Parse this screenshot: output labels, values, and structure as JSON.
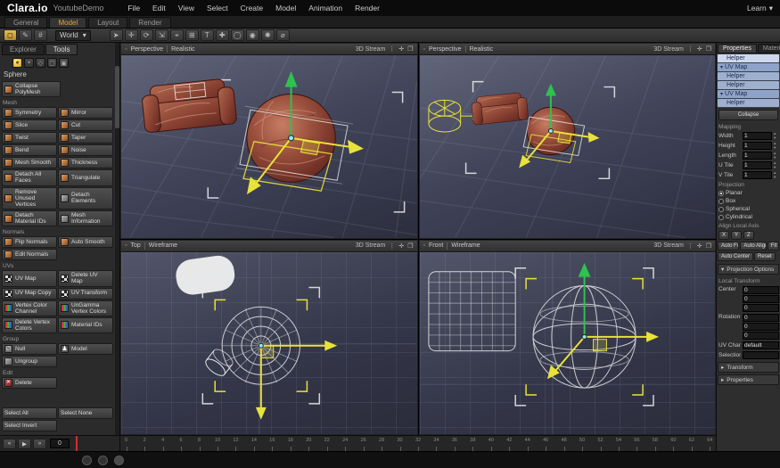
{
  "icons": {
    "caret_down": "▾",
    "caret_right": "▸",
    "kebab": "⋮",
    "move": "✛",
    "expand": "❐",
    "panel": "▫",
    "prev": "«",
    "play": "▶",
    "next": "»",
    "up": "▴",
    "down": "▾"
  },
  "colors": {
    "accent": "#f0a231",
    "gizmo_yellow": "#e8e23a",
    "gizmo_green": "#2ec24e",
    "selection_blue": "#9fb0cf"
  },
  "topbar": {
    "logo": "Clara.io",
    "project": "YoutubeDemo",
    "menus": [
      "File",
      "Edit",
      "View",
      "Select",
      "Create",
      "Model",
      "Animation",
      "Render"
    ],
    "learn": "Learn"
  },
  "tabbar": {
    "tabs": [
      "General",
      "Model",
      "Layout",
      "Render"
    ],
    "active": "Model"
  },
  "toolbar": {
    "left_icons": [
      {
        "name": "select-mode-icon",
        "glyph": "◻",
        "active": true
      },
      {
        "name": "paint-select-icon",
        "glyph": "✎",
        "active": false
      },
      {
        "name": "snap-toggle-icon",
        "glyph": "#",
        "active": false
      }
    ],
    "space_label": "World",
    "icons": [
      {
        "name": "select-tool-icon",
        "glyph": "➤"
      },
      {
        "name": "translate-tool-icon",
        "glyph": "✛"
      },
      {
        "name": "rotate-tool-icon",
        "glyph": "⟳"
      },
      {
        "name": "scale-tool-icon",
        "glyph": "⇲"
      },
      {
        "name": "pivot-tool-icon",
        "glyph": "⌖"
      },
      {
        "name": "snap-grid-icon",
        "glyph": "⊞"
      },
      {
        "name": "text-tool-icon",
        "glyph": "T"
      },
      {
        "name": "add-object-icon",
        "glyph": "✚"
      },
      {
        "name": "circle-tool-icon",
        "glyph": "◯"
      },
      {
        "name": "sphere-tool-icon",
        "glyph": "◉"
      },
      {
        "name": "light-tool-icon",
        "glyph": "✺"
      },
      {
        "name": "measure-tool-icon",
        "glyph": "⌀"
      }
    ]
  },
  "sidebar": {
    "tabs": [
      "Explorer",
      "Tools"
    ],
    "active_tab": "Tools",
    "mode_icons": [
      {
        "name": "object-mode-icon",
        "glyph": "●",
        "active": true
      },
      {
        "name": "vertex-mode-icon",
        "glyph": "▪",
        "active": false
      },
      {
        "name": "edge-mode-icon",
        "glyph": "◇",
        "active": false
      },
      {
        "name": "face-mode-icon",
        "glyph": "▢",
        "active": false
      },
      {
        "name": "element-mode-icon",
        "glyph": "▣",
        "active": false
      }
    ],
    "object_name": "Sphere",
    "collapse_button": "Collapse PolyMesh",
    "sections": [
      {
        "label": "Mesh",
        "buttons": [
          {
            "l": "Symmetry",
            "i": "mesh"
          },
          {
            "l": "Mirror",
            "i": "mesh"
          },
          {
            "l": "Slice",
            "i": "mesh"
          },
          {
            "l": "Cut",
            "i": "mesh"
          },
          {
            "l": "Twist",
            "i": "mesh"
          },
          {
            "l": "Taper",
            "i": "mesh"
          },
          {
            "l": "Bend",
            "i": "mesh"
          },
          {
            "l": "Noise",
            "i": "mesh"
          },
          {
            "l": "Mesh Smooth",
            "i": "mesh"
          },
          {
            "l": "Thickness",
            "i": "mesh"
          },
          {
            "l": "Detach All Faces",
            "i": "mesh"
          },
          {
            "l": "Triangulate",
            "i": "mesh"
          },
          {
            "l": "Remove Unused Vertices",
            "i": "mesh"
          },
          {
            "l": "Detach Elements",
            "i": "gray"
          },
          {
            "l": "Detach Material IDs",
            "i": "mesh"
          },
          {
            "l": "Mesh Information",
            "i": "gray"
          }
        ]
      },
      {
        "label": "Normals",
        "buttons": [
          {
            "l": "Flip Normals",
            "i": "mesh"
          },
          {
            "l": "Auto Smooth",
            "i": "mesh"
          },
          {
            "l": "Edit Normals",
            "i": "mesh"
          }
        ]
      },
      {
        "label": "UVs",
        "buttons": [
          {
            "l": "UV Map",
            "i": "checker"
          },
          {
            "l": "Delete UV Map",
            "i": "checker"
          },
          {
            "l": "UV Map Copy",
            "i": "checker"
          },
          {
            "l": "UV Transform",
            "i": "checker"
          },
          {
            "l": "Vertex Color Channel",
            "i": "rgb"
          },
          {
            "l": "UnGamma Vertex Colors",
            "i": "rgb"
          },
          {
            "l": "Delete Vertex Colors",
            "i": "rgb"
          },
          {
            "l": "Material IDs",
            "i": "rgb"
          }
        ]
      },
      {
        "label": "Group",
        "buttons": [
          {
            "l": "Null",
            "i": "null",
            "g": "∅"
          },
          {
            "l": "Model",
            "i": "model",
            "g": "♟"
          },
          {
            "l": "Ungroup",
            "i": "gray"
          }
        ]
      },
      {
        "label": "Edit",
        "buttons": [
          {
            "l": "Delete",
            "i": "delete",
            "g": "✕"
          }
        ]
      }
    ],
    "select_buttons": [
      "Select All",
      "Select None",
      "Select Invert"
    ]
  },
  "viewports": [
    {
      "mode": "Perspective",
      "shading": "Realistic",
      "stream": "3D Stream"
    },
    {
      "mode": "Perspective",
      "shading": "Realistic",
      "stream": "3D Stream"
    },
    {
      "mode": "Top",
      "shading": "Wireframe",
      "stream": "3D Stream"
    },
    {
      "mode": "Front",
      "shading": "Wireframe",
      "stream": "3D Stream"
    }
  ],
  "panel": {
    "tabs": [
      "Properties",
      "Material"
    ],
    "active_tab": "Properties",
    "tree": [
      {
        "label": "Helper",
        "cls": "sel"
      },
      {
        "label": "UV Map",
        "cls": "uv",
        "arrow": true
      },
      {
        "label": "Helper",
        "cls": "child"
      },
      {
        "label": "Helper",
        "cls": "child"
      },
      {
        "label": "UV Map",
        "cls": "uv",
        "arrow": true
      },
      {
        "label": "Helper",
        "cls": "child"
      }
    ],
    "collapse_button": "Collapse",
    "mapping_label": "Mapping",
    "fields": [
      {
        "label": "Width",
        "value": "1"
      },
      {
        "label": "Height",
        "value": "1"
      },
      {
        "label": "Length",
        "value": "1"
      },
      {
        "label": "U Tile",
        "value": "1"
      },
      {
        "label": "V Tile",
        "value": "1"
      }
    ],
    "projection_label": "Projection",
    "projection_options": [
      {
        "label": "Planar",
        "on": true
      },
      {
        "label": "Box",
        "on": false
      },
      {
        "label": "Spherical",
        "on": false
      },
      {
        "label": "Cylindrical",
        "on": false
      }
    ],
    "align_label": "Align Local Axis",
    "axes": [
      "X",
      "Y",
      "Z"
    ],
    "buttons_row1": [
      "Auto Fit",
      "Auto Align",
      "Fit"
    ],
    "buttons_row2": [
      "Auto Center",
      "Reset"
    ],
    "projection_options_label": "Projection Options",
    "local_transform_label": "Local Transform",
    "center_label": "Center",
    "center_values": [
      "0",
      "0",
      "0"
    ],
    "rotation_label": "Rotation",
    "rotation_values": [
      "0",
      "0",
      "0"
    ],
    "uv_channel_label": "UV Channel",
    "uv_channel_value": "default",
    "selection_label": "Selection",
    "selection_value": "",
    "collapsed_sections": [
      "Transform",
      "Properties"
    ]
  },
  "timeline": {
    "frame": "0",
    "tick_count": 33,
    "tick_step": 2
  }
}
